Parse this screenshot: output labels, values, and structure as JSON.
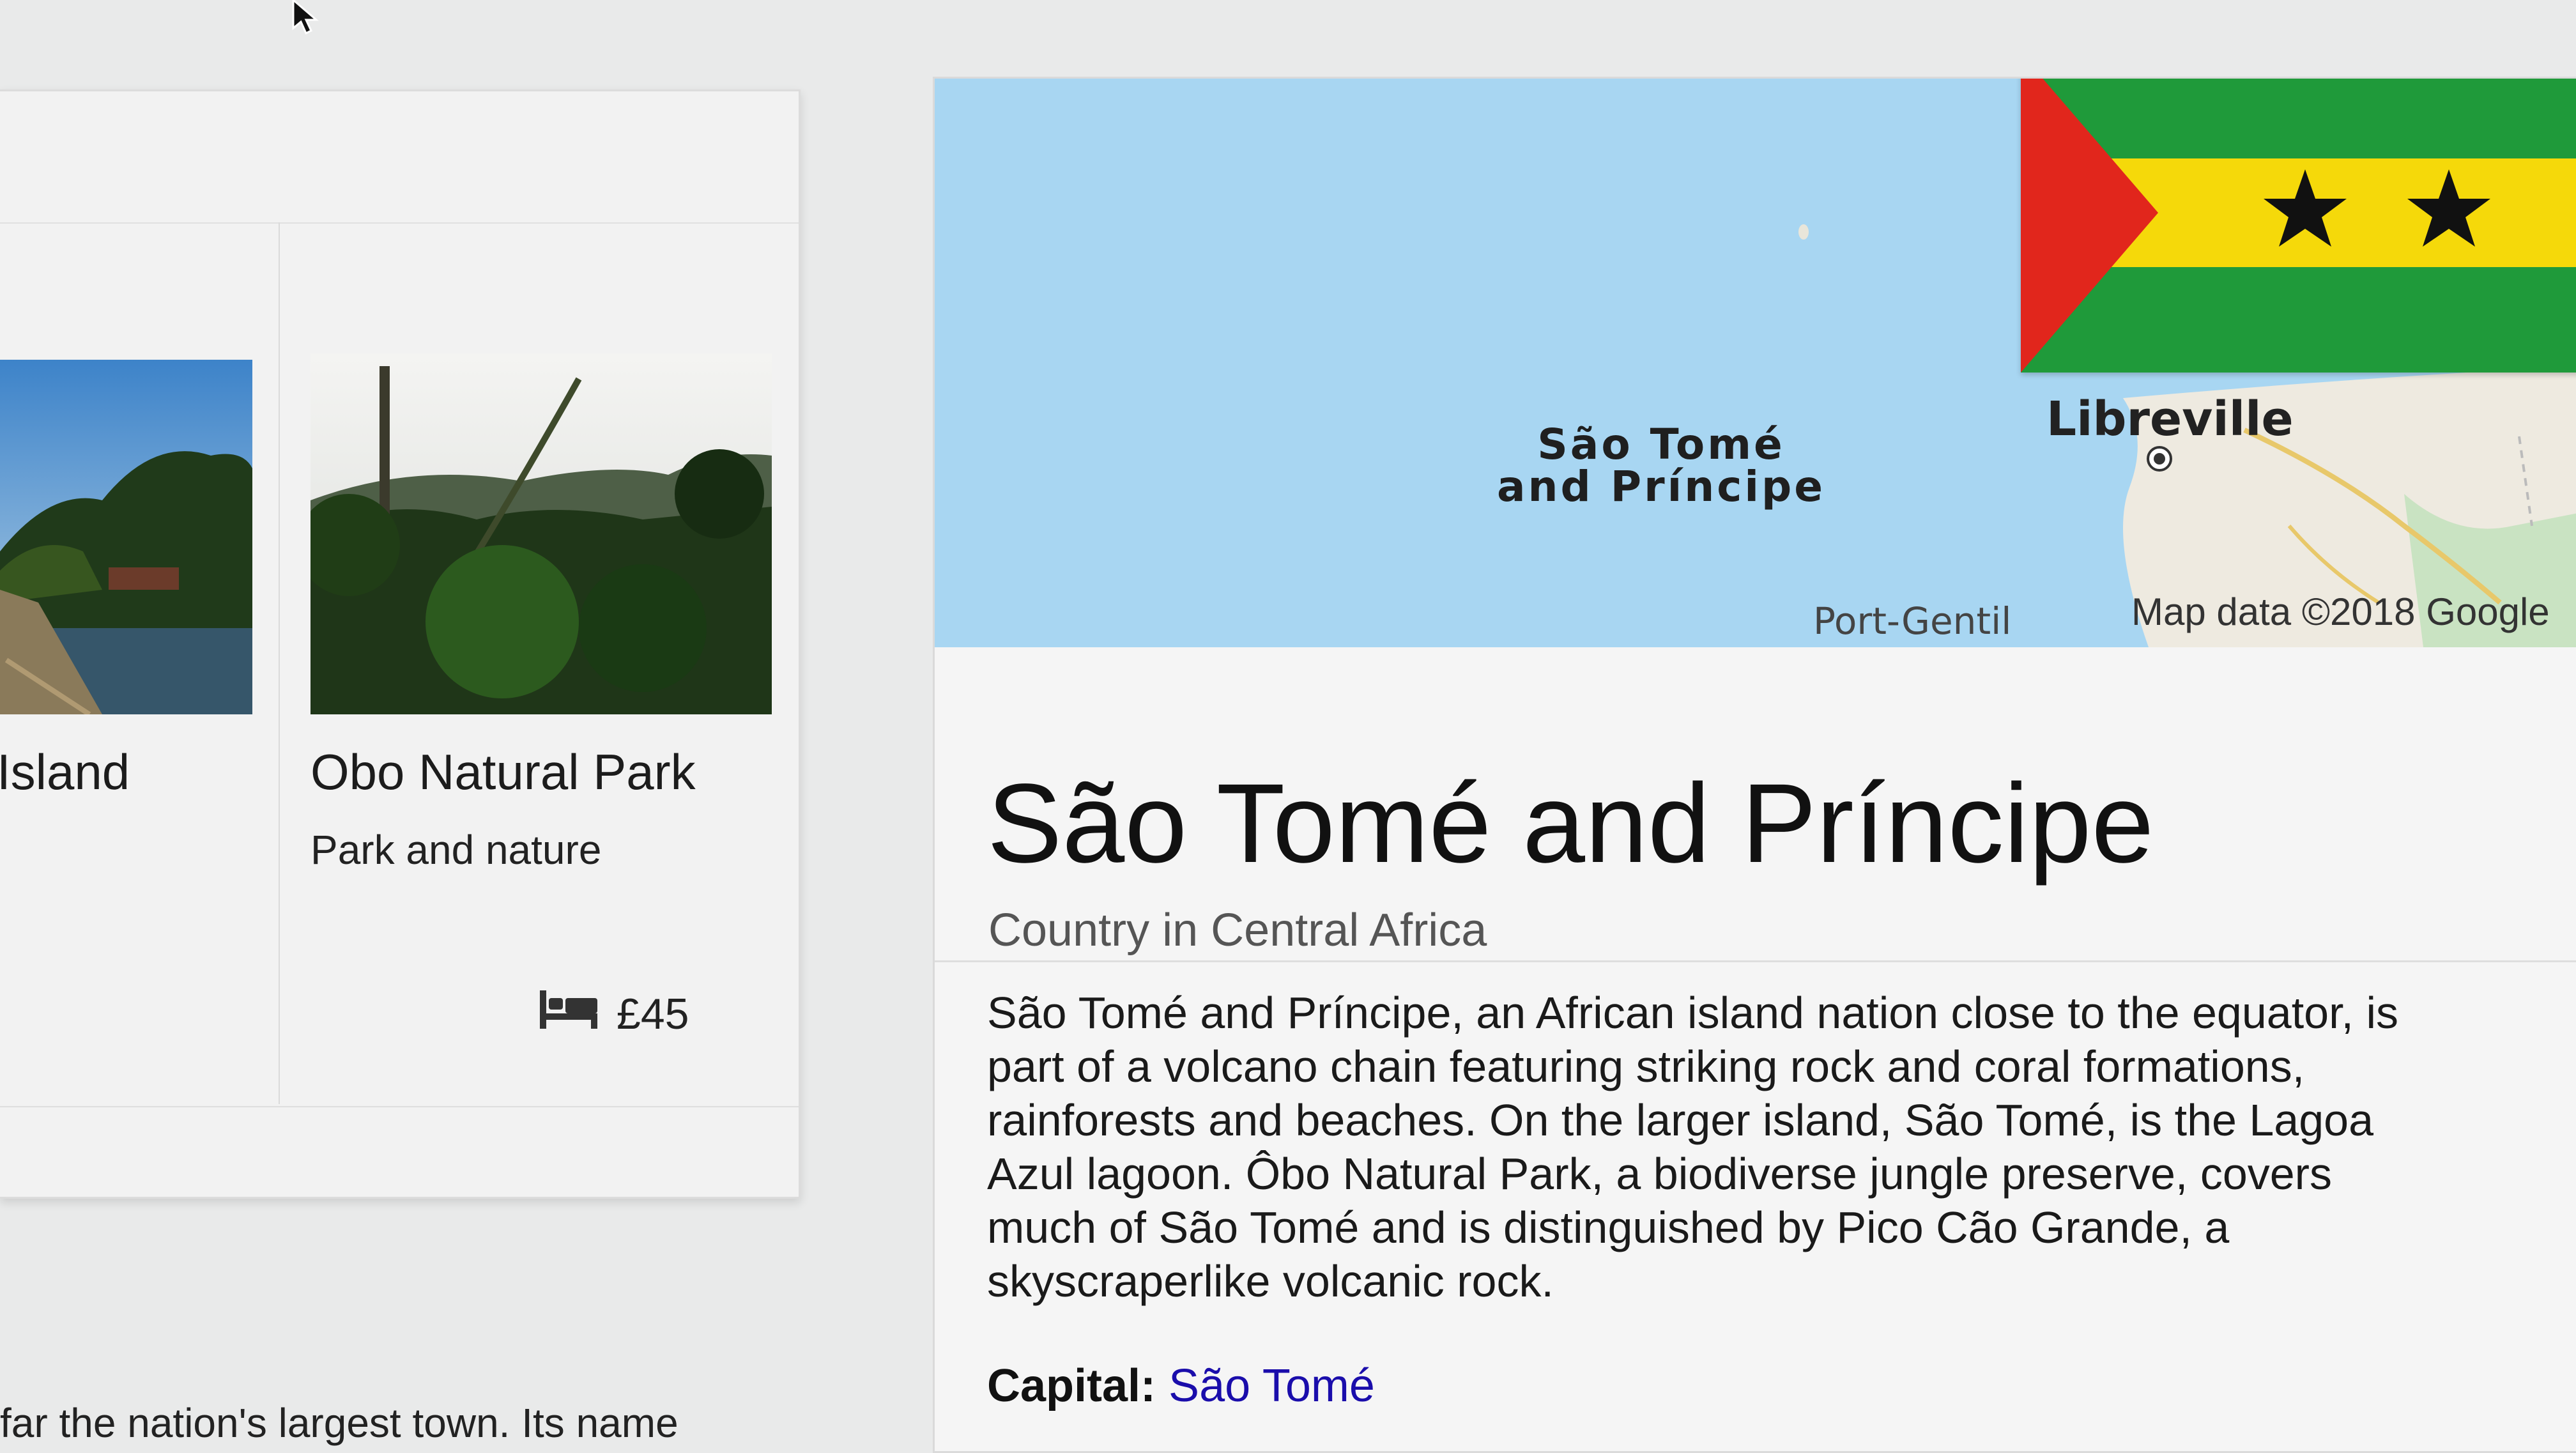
{
  "places": [
    {
      "title": "Island",
      "subtitle": ""
    },
    {
      "title": "Obo Natural Park",
      "subtitle": "Park and nature",
      "price": "£45"
    }
  ],
  "snippet": "far the nation's largest town. Its name",
  "map": {
    "country_label_line1": "São Tomé",
    "country_label_line2": "and Príncipe",
    "city": "Libreville",
    "city2": "Port-Gentil",
    "credit": "Map data ©2018 Google"
  },
  "knowledge_panel": {
    "title": "São Tomé and Príncipe",
    "subtitle": "Country in Central Africa",
    "description_lines": [
      "São Tomé and Príncipe, an African island nation close to the equator, is",
      "part of a volcano chain featuring striking rock and coral formations,",
      "rainforests and beaches. On the larger island, São Tomé, is the Lagoa",
      "Azul lagoon. Ôbo Natural Park, a biodiverse jungle preserve, covers",
      "much of São Tomé and is distinguished by Pico Cão Grande, a",
      "skyscraperlike volcanic rock."
    ],
    "capital_label": "Capital:",
    "capital_value": "São Tomé"
  },
  "colors": {
    "link": "#1a0dab",
    "water": "#a8d6f2",
    "flag_green": "#1f9a3a",
    "flag_yellow": "#f5d90a",
    "flag_red": "#e1261c"
  },
  "icons": [
    "cursor-icon",
    "bed-icon",
    "star-icon",
    "city-marker-icon"
  ]
}
